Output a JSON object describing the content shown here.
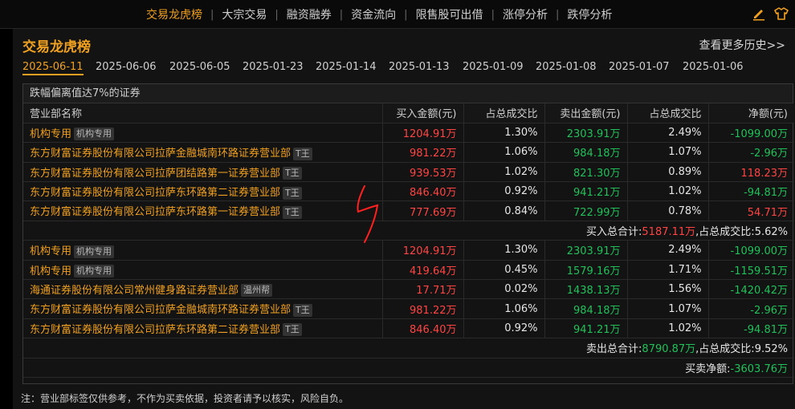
{
  "nav": {
    "items": [
      "交易龙虎榜",
      "大宗交易",
      "融资融券",
      "资金流向",
      "限售股可出借",
      "涨停分析",
      "跌停分析"
    ],
    "active": "交易龙虎榜",
    "icons": [
      "edit-icon",
      "shirt-icon"
    ]
  },
  "panel": {
    "title": "交易龙虎榜",
    "more": "查看更多历史>>"
  },
  "dates": [
    "2025-06-11",
    "2025-06-06",
    "2025-06-05",
    "2025-01-23",
    "2025-01-14",
    "2025-01-13",
    "2025-01-09",
    "2025-01-08",
    "2025-01-07",
    "2025-01-06"
  ],
  "active_date": "2025-06-11",
  "section": {
    "title": "跌幅偏离值达7%的证券",
    "headers": [
      "营业部名称",
      "买入金额(元)",
      "占总成交比",
      "卖出金额(元)",
      "占总成交比",
      "净额(元)"
    ],
    "buy_rows": [
      {
        "name": "机构专用",
        "tag": "机构专用",
        "buy": "1204.91万",
        "buy_pct": "1.30%",
        "sell": "2303.91万",
        "sell_pct": "2.49%",
        "net": "-1099.00万"
      },
      {
        "name": "东方财富证券股份有限公司拉萨金融城南环路证券营业部",
        "tag": "T王",
        "buy": "981.22万",
        "buy_pct": "1.06%",
        "sell": "984.18万",
        "sell_pct": "1.07%",
        "net": "-2.96万"
      },
      {
        "name": "东方财富证券股份有限公司拉萨团结路第一证券营业部",
        "tag": "T王",
        "buy": "939.53万",
        "buy_pct": "1.02%",
        "sell": "821.30万",
        "sell_pct": "0.89%",
        "net": "118.23万"
      },
      {
        "name": "东方财富证券股份有限公司拉萨东环路第二证券营业部",
        "tag": "T王",
        "buy": "846.40万",
        "buy_pct": "0.92%",
        "sell": "941.21万",
        "sell_pct": "1.02%",
        "net": "-94.81万"
      },
      {
        "name": "东方财富证券股份有限公司拉萨东环路第一证券营业部",
        "tag": "T王",
        "buy": "777.69万",
        "buy_pct": "0.84%",
        "sell": "722.99万",
        "sell_pct": "0.78%",
        "net": "54.71万"
      }
    ],
    "buy_summary": {
      "label1": "买入总合计:",
      "value1": "5187.11万",
      "label2": ",占总成交比:",
      "value2": "5.62%"
    },
    "sell_rows": [
      {
        "name": "机构专用",
        "tag": "机构专用",
        "buy": "1204.91万",
        "buy_pct": "1.30%",
        "sell": "2303.91万",
        "sell_pct": "2.49%",
        "net": "-1099.00万"
      },
      {
        "name": "机构专用",
        "tag": "机构专用",
        "buy": "419.64万",
        "buy_pct": "0.45%",
        "sell": "1579.16万",
        "sell_pct": "1.71%",
        "net": "-1159.51万"
      },
      {
        "name": "海通证券股份有限公司常州健身路证券营业部",
        "tag": "温州帮",
        "buy": "17.71万",
        "buy_pct": "0.02%",
        "sell": "1438.13万",
        "sell_pct": "1.56%",
        "net": "-1420.42万"
      },
      {
        "name": "东方财富证券股份有限公司拉萨金融城南环路证券营业部",
        "tag": "T王",
        "buy": "981.22万",
        "buy_pct": "1.06%",
        "sell": "984.18万",
        "sell_pct": "1.07%",
        "net": "-2.96万"
      },
      {
        "name": "东方财富证券股份有限公司拉萨东环路第二证券营业部",
        "tag": "T王",
        "buy": "846.40万",
        "buy_pct": "0.92%",
        "sell": "941.21万",
        "sell_pct": "1.02%",
        "net": "-94.81万"
      }
    ],
    "sell_summary": {
      "label1": "卖出总合计:",
      "value1": "8790.87万",
      "label2": ",占总成交比:",
      "value2": "9.52%"
    },
    "net_summary": {
      "label": "买卖净额:",
      "value": "-3603.76万"
    }
  },
  "footnote": "注：营业部标签仅供参考，不作为买卖依据，投资者请予以核实，风险自负。",
  "colors": {
    "accent": "#f0a020",
    "up": "#ff4444",
    "down": "#21c05a",
    "scribble": "#ff2020"
  }
}
